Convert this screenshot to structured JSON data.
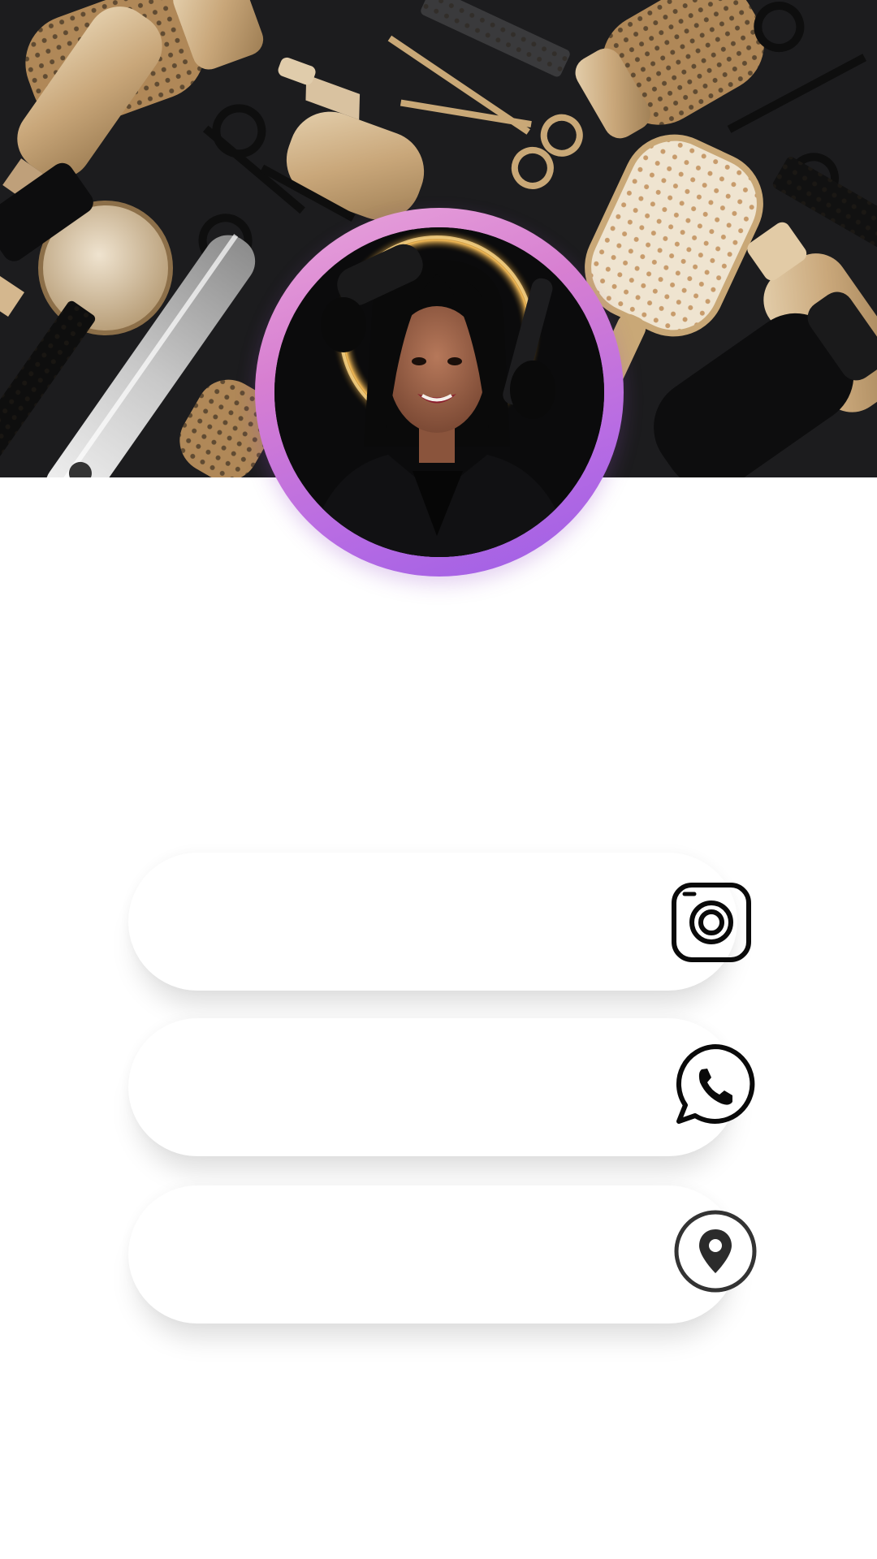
{
  "profile": {
    "avatar_icon": "profile-photo",
    "ring_colors": [
      "#e9a6dc",
      "#d77fd1",
      "#b86ce3",
      "#9c5de6"
    ]
  },
  "cover": {
    "image": "hair-styling-tools-flatlay",
    "background_color": "#1c1c1e",
    "tool_color_gold": "#cdb18a"
  },
  "links": [
    {
      "id": "instagram",
      "label": "",
      "icon": "instagram-icon"
    },
    {
      "id": "whatsapp",
      "label": "",
      "icon": "whatsapp-icon"
    },
    {
      "id": "location",
      "label": "",
      "icon": "map-pin-icon"
    }
  ]
}
